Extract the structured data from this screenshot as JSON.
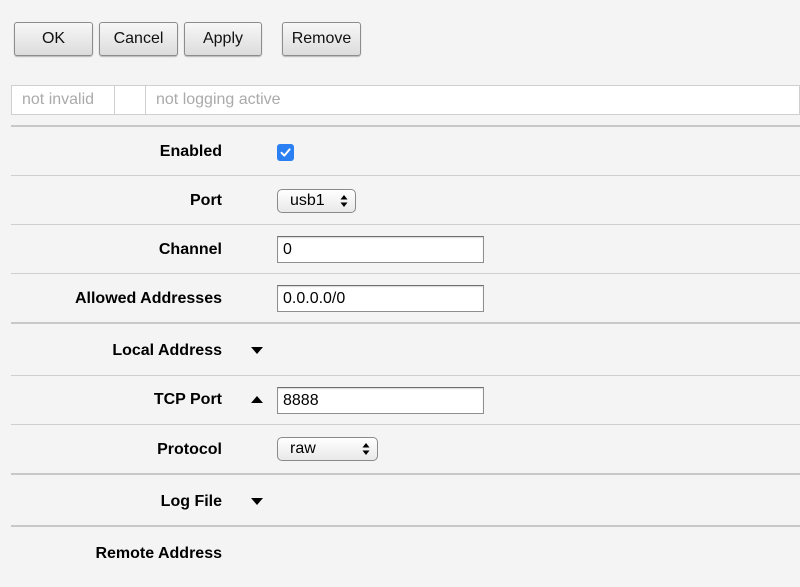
{
  "toolbar": {
    "ok_label": "OK",
    "cancel_label": "Cancel",
    "apply_label": "Apply",
    "remove_label": "Remove"
  },
  "status": {
    "cell1": "not invalid",
    "cell2": "",
    "cell3": "not logging active"
  },
  "form": {
    "enabled": {
      "label": "Enabled",
      "checked": true
    },
    "port": {
      "label": "Port",
      "value": "usb1"
    },
    "channel": {
      "label": "Channel",
      "value": "0"
    },
    "allowed_addresses": {
      "label": "Allowed Addresses",
      "value": "0.0.0.0/0"
    },
    "local_address": {
      "label": "Local Address",
      "icon": "expand-down-icon"
    },
    "tcp_port": {
      "label": "TCP Port",
      "value": "8888",
      "icon": "collapse-up-icon"
    },
    "protocol": {
      "label": "Protocol",
      "value": "raw"
    },
    "log_file": {
      "label": "Log File",
      "icon": "expand-down-icon"
    },
    "remote_address": {
      "label": "Remote Address"
    }
  },
  "colors": {
    "checkbox_accent": "#2a7ff3",
    "background": "#f4f4f4"
  }
}
